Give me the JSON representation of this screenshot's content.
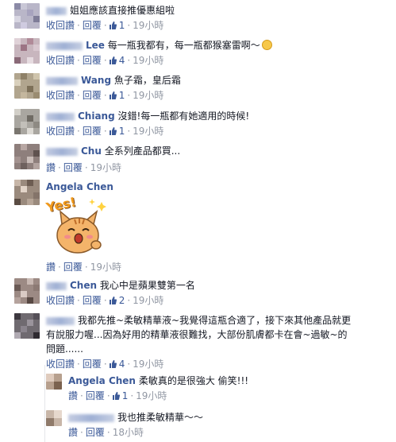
{
  "actions": {
    "retract": "收回讚",
    "like": "讚",
    "reply": "回覆"
  },
  "comments": [
    {
      "name": "",
      "text": "姐姐應該直接推優惠組啦",
      "retract": true,
      "likes": "1",
      "time": "19小時"
    },
    {
      "name": "Lee",
      "text": "每一瓶我都有，每一瓶都猴塞雷啊～",
      "retract": true,
      "likes": "4",
      "time": "19小時"
    },
    {
      "name": "Wang",
      "text": "魚子霜，皇后霜",
      "retract": true,
      "likes": "1",
      "time": "19小時"
    },
    {
      "name": "Chiang",
      "text": "沒錯!每一瓶都有她適用的時候!",
      "retract": true,
      "likes": "1",
      "time": "19小時"
    },
    {
      "name": "Chu",
      "text": "全系列產品都買...",
      "retract": false,
      "likes": "",
      "time": "19小時"
    },
    {
      "name": "Angela Chen",
      "text": "",
      "sticker": "Yes!",
      "retract": false,
      "likes": "",
      "time": "19小時"
    },
    {
      "name": "Chen",
      "text": "我心中是蘋果雙第一名",
      "retract": true,
      "likes": "2",
      "time": "19小時"
    },
    {
      "name": "",
      "text_lines": [
        "我都先推~柔敏精華液~我覺得這瓶合適了，接下來其他產品就更",
        "有說服力喔...因為好用的精華液很難找，大部份肌膚都卡在會~過敏~的",
        "問題......"
      ],
      "retract": true,
      "likes": "4",
      "time": "19小時"
    },
    {
      "name": "Angela Chen",
      "text": "柔敏真的是很強大 偷笑!!!",
      "retract": false,
      "likes": "1",
      "time": "19小時"
    },
    {
      "name": "",
      "text": "我也推柔敏精華～～",
      "retract": false,
      "likes": "",
      "time": "18小時"
    }
  ],
  "colors": {
    "link": "#3b5998",
    "meta": "#9197a3",
    "text": "#141823"
  }
}
